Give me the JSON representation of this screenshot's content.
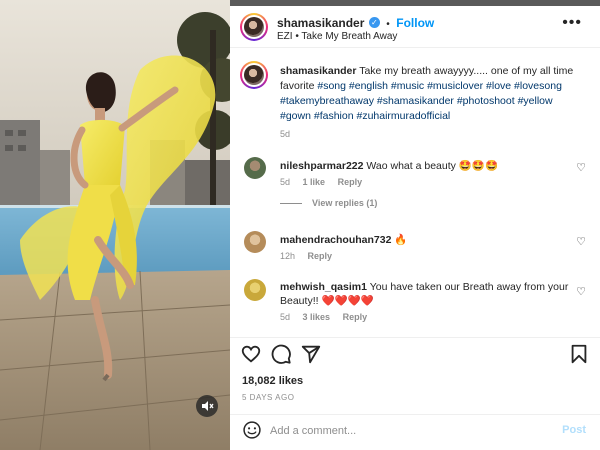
{
  "post": {
    "author": "shamasikander",
    "follow_label": "Follow",
    "separator": "•",
    "audio": "EZI • Take My Breath Away",
    "more_label": "•••",
    "caption": {
      "username": "shamasikander",
      "text": "Take my breath awayyyy..... one of my all time favorite",
      "hashtags": "#song #english #music #musiclover #love #lovesong #takemybreathaway #shamasikander #photoshoot #yellow #gown #fashion #zuhairmuradofficial",
      "time": "5d"
    }
  },
  "comments": [
    {
      "username": "nileshparmar222",
      "text": "Wao what a beauty 🤩🤩🤩",
      "time": "5d",
      "likes": "1 like",
      "reply": "Reply",
      "view_replies": "View replies (1)"
    },
    {
      "username": "mahendrachouhan732",
      "text": "🔥",
      "time": "12h",
      "reply": "Reply"
    },
    {
      "username": "mehwish_qasim1",
      "text": "You have taken our Breath away from your Beauty!! ❤️❤️❤️❤️",
      "time": "5d",
      "likes": "3 likes",
      "reply": "Reply"
    }
  ],
  "stats": {
    "likes": "18,082 likes",
    "ago": "5 DAYS AGO"
  },
  "composer": {
    "placeholder": "Add a comment...",
    "post_label": "Post"
  },
  "icons": [
    "verified-badge-icon",
    "more-options-icon",
    "heart-icon",
    "comment-icon",
    "share-icon",
    "bookmark-icon",
    "emoji-icon",
    "mute-icon"
  ],
  "colors": {
    "accent": "#0095f6",
    "gown": "#f2e34a",
    "post_disabled": "#b2dffc"
  }
}
